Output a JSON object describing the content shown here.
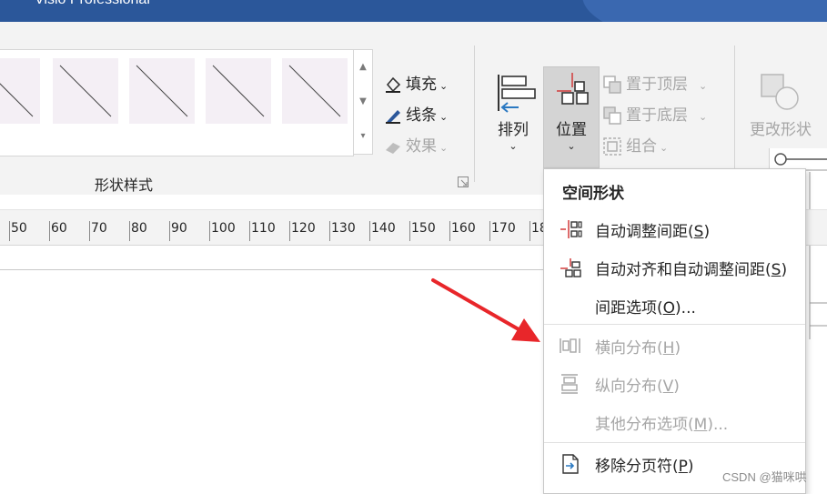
{
  "app": {
    "title": "Visio Professional"
  },
  "ribbon": {
    "shape_styles_label": "形状样式",
    "fill_label": "填充",
    "line_label": "线条",
    "effects_label": "效果",
    "arrange_label": "排列",
    "position_label": "位置",
    "bring_to_front_label": "置于顶层",
    "send_to_back_label": "置于底层",
    "group_label": "组合",
    "change_shape_label": "更改形状"
  },
  "ruler": {
    "numbers": [
      "50",
      "60",
      "70",
      "80",
      "90",
      "100",
      "110",
      "120",
      "130",
      "140",
      "150",
      "160",
      "170",
      "18"
    ]
  },
  "position_menu": {
    "header": "空间形状",
    "items": [
      {
        "label": "自动调整间距",
        "key": "S",
        "enabled": true
      },
      {
        "label": "自动对齐和自动调整间距",
        "key": "S",
        "enabled": true
      },
      {
        "label": "间距选项",
        "key": "O",
        "suffix": "...",
        "enabled": true
      },
      {
        "label": "横向分布",
        "key": "H",
        "enabled": false
      },
      {
        "label": "纵向分布",
        "key": "V",
        "enabled": false
      },
      {
        "label": "其他分布选项",
        "key": "M",
        "suffix": "...",
        "enabled": false
      },
      {
        "label": "移除分页符",
        "key": "P",
        "enabled": true
      }
    ]
  },
  "watermark": "CSDN @猫咪哄",
  "colors": {
    "title_bar": "#2b579a",
    "annotation_arrow": "#e8262a",
    "icon_accent": "#d23a3a"
  }
}
